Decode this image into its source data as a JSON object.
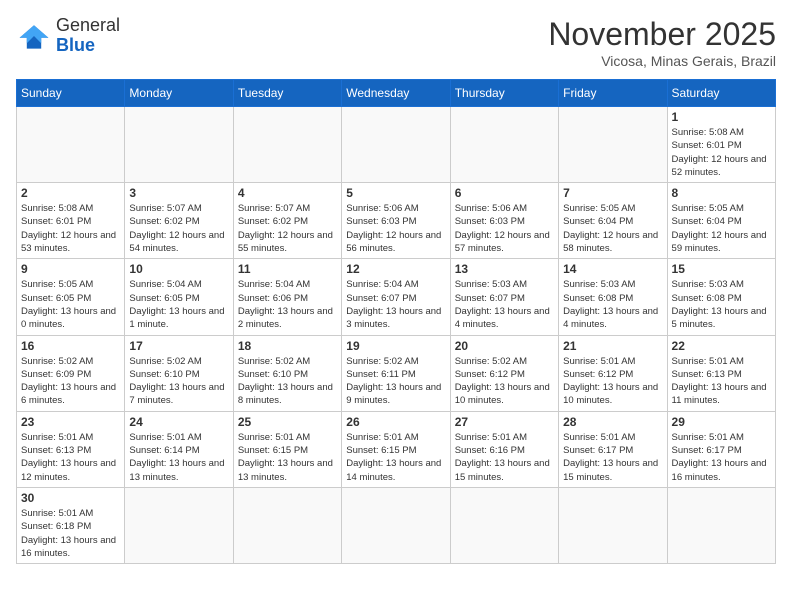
{
  "header": {
    "logo_general": "General",
    "logo_blue": "Blue",
    "month_title": "November 2025",
    "location": "Vicosa, Minas Gerais, Brazil"
  },
  "weekdays": [
    "Sunday",
    "Monday",
    "Tuesday",
    "Wednesday",
    "Thursday",
    "Friday",
    "Saturday"
  ],
  "weeks": [
    [
      {
        "day": "",
        "info": ""
      },
      {
        "day": "",
        "info": ""
      },
      {
        "day": "",
        "info": ""
      },
      {
        "day": "",
        "info": ""
      },
      {
        "day": "",
        "info": ""
      },
      {
        "day": "",
        "info": ""
      },
      {
        "day": "1",
        "info": "Sunrise: 5:08 AM\nSunset: 6:01 PM\nDaylight: 12 hours\nand 52 minutes."
      }
    ],
    [
      {
        "day": "2",
        "info": "Sunrise: 5:08 AM\nSunset: 6:01 PM\nDaylight: 12 hours\nand 53 minutes."
      },
      {
        "day": "3",
        "info": "Sunrise: 5:07 AM\nSunset: 6:02 PM\nDaylight: 12 hours\nand 54 minutes."
      },
      {
        "day": "4",
        "info": "Sunrise: 5:07 AM\nSunset: 6:02 PM\nDaylight: 12 hours\nand 55 minutes."
      },
      {
        "day": "5",
        "info": "Sunrise: 5:06 AM\nSunset: 6:03 PM\nDaylight: 12 hours\nand 56 minutes."
      },
      {
        "day": "6",
        "info": "Sunrise: 5:06 AM\nSunset: 6:03 PM\nDaylight: 12 hours\nand 57 minutes."
      },
      {
        "day": "7",
        "info": "Sunrise: 5:05 AM\nSunset: 6:04 PM\nDaylight: 12 hours\nand 58 minutes."
      },
      {
        "day": "8",
        "info": "Sunrise: 5:05 AM\nSunset: 6:04 PM\nDaylight: 12 hours\nand 59 minutes."
      }
    ],
    [
      {
        "day": "9",
        "info": "Sunrise: 5:05 AM\nSunset: 6:05 PM\nDaylight: 13 hours\nand 0 minutes."
      },
      {
        "day": "10",
        "info": "Sunrise: 5:04 AM\nSunset: 6:05 PM\nDaylight: 13 hours\nand 1 minute."
      },
      {
        "day": "11",
        "info": "Sunrise: 5:04 AM\nSunset: 6:06 PM\nDaylight: 13 hours\nand 2 minutes."
      },
      {
        "day": "12",
        "info": "Sunrise: 5:04 AM\nSunset: 6:07 PM\nDaylight: 13 hours\nand 3 minutes."
      },
      {
        "day": "13",
        "info": "Sunrise: 5:03 AM\nSunset: 6:07 PM\nDaylight: 13 hours\nand 4 minutes."
      },
      {
        "day": "14",
        "info": "Sunrise: 5:03 AM\nSunset: 6:08 PM\nDaylight: 13 hours\nand 4 minutes."
      },
      {
        "day": "15",
        "info": "Sunrise: 5:03 AM\nSunset: 6:08 PM\nDaylight: 13 hours\nand 5 minutes."
      }
    ],
    [
      {
        "day": "16",
        "info": "Sunrise: 5:02 AM\nSunset: 6:09 PM\nDaylight: 13 hours\nand 6 minutes."
      },
      {
        "day": "17",
        "info": "Sunrise: 5:02 AM\nSunset: 6:10 PM\nDaylight: 13 hours\nand 7 minutes."
      },
      {
        "day": "18",
        "info": "Sunrise: 5:02 AM\nSunset: 6:10 PM\nDaylight: 13 hours\nand 8 minutes."
      },
      {
        "day": "19",
        "info": "Sunrise: 5:02 AM\nSunset: 6:11 PM\nDaylight: 13 hours\nand 9 minutes."
      },
      {
        "day": "20",
        "info": "Sunrise: 5:02 AM\nSunset: 6:12 PM\nDaylight: 13 hours\nand 10 minutes."
      },
      {
        "day": "21",
        "info": "Sunrise: 5:01 AM\nSunset: 6:12 PM\nDaylight: 13 hours\nand 10 minutes."
      },
      {
        "day": "22",
        "info": "Sunrise: 5:01 AM\nSunset: 6:13 PM\nDaylight: 13 hours\nand 11 minutes."
      }
    ],
    [
      {
        "day": "23",
        "info": "Sunrise: 5:01 AM\nSunset: 6:13 PM\nDaylight: 13 hours\nand 12 minutes."
      },
      {
        "day": "24",
        "info": "Sunrise: 5:01 AM\nSunset: 6:14 PM\nDaylight: 13 hours\nand 13 minutes."
      },
      {
        "day": "25",
        "info": "Sunrise: 5:01 AM\nSunset: 6:15 PM\nDaylight: 13 hours\nand 13 minutes."
      },
      {
        "day": "26",
        "info": "Sunrise: 5:01 AM\nSunset: 6:15 PM\nDaylight: 13 hours\nand 14 minutes."
      },
      {
        "day": "27",
        "info": "Sunrise: 5:01 AM\nSunset: 6:16 PM\nDaylight: 13 hours\nand 15 minutes."
      },
      {
        "day": "28",
        "info": "Sunrise: 5:01 AM\nSunset: 6:17 PM\nDaylight: 13 hours\nand 15 minutes."
      },
      {
        "day": "29",
        "info": "Sunrise: 5:01 AM\nSunset: 6:17 PM\nDaylight: 13 hours\nand 16 minutes."
      }
    ],
    [
      {
        "day": "30",
        "info": "Sunrise: 5:01 AM\nSunset: 6:18 PM\nDaylight: 13 hours\nand 16 minutes."
      },
      {
        "day": "",
        "info": ""
      },
      {
        "day": "",
        "info": ""
      },
      {
        "day": "",
        "info": ""
      },
      {
        "day": "",
        "info": ""
      },
      {
        "day": "",
        "info": ""
      },
      {
        "day": "",
        "info": ""
      }
    ]
  ]
}
